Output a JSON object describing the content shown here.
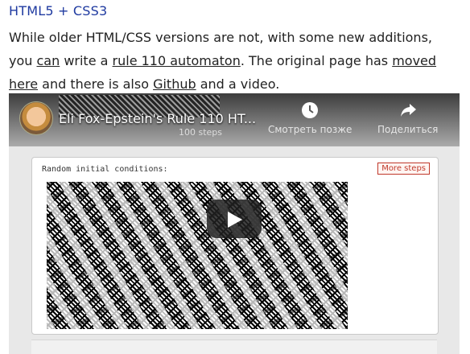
{
  "heading": "HTML5 + CSS3",
  "paragraph": {
    "t1": "While older HTML/CSS versions are not, with some new additions, you ",
    "link_can": "can",
    "t2": " write a ",
    "link_rule": "rule 110 automaton",
    "t3": ". The original page has ",
    "link_moved": "moved here",
    "t4": " and there is also ",
    "link_github": "Github",
    "t5": " and a video."
  },
  "video": {
    "title": "Eli Fox-Epstein's Rule 110 HT...",
    "watch_later": "Смотреть позже",
    "share": "Поделиться",
    "steps_label": "100 steps",
    "panel_label": "Random initial conditions:",
    "more_steps": "More steps"
  }
}
